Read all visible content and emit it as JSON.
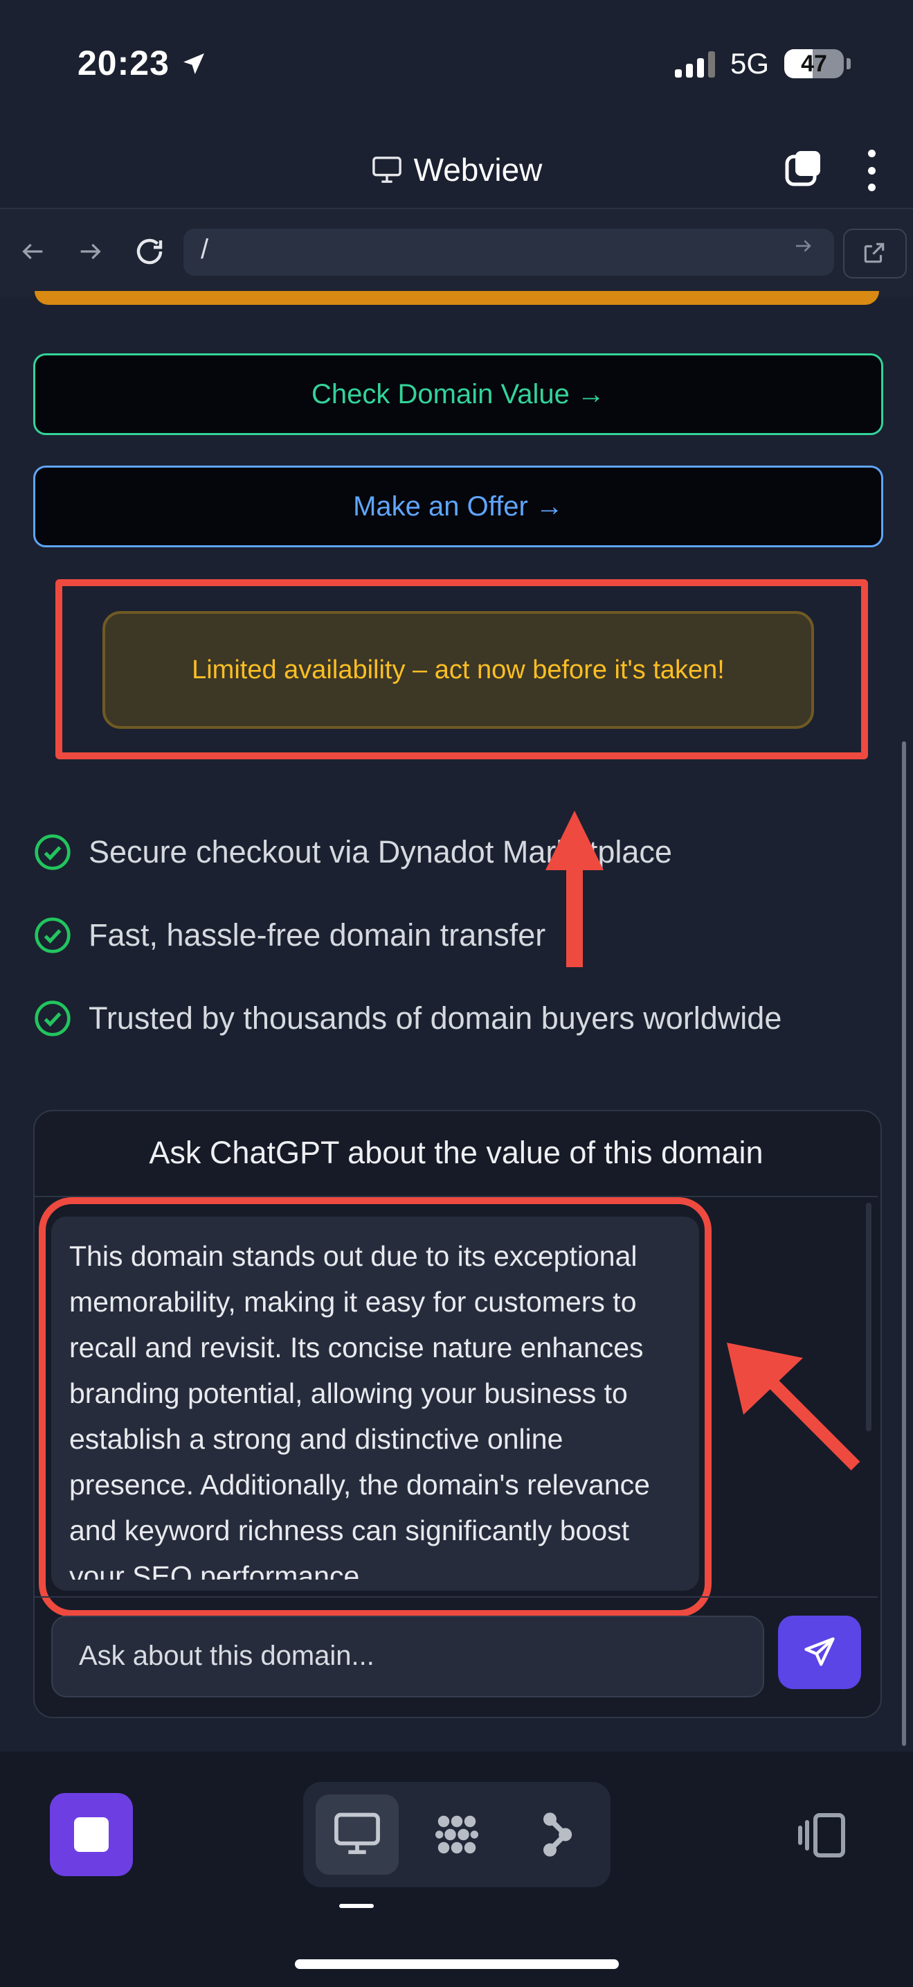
{
  "status_bar": {
    "time": "20:23",
    "network": "5G",
    "battery": "47"
  },
  "header": {
    "title": "Webview"
  },
  "nav": {
    "url": "/"
  },
  "page": {
    "check_value_label": "Check Domain Value →",
    "make_offer_label": "Make an Offer →",
    "notice": "Limited availability – act now before it's taken!",
    "features": [
      "Secure checkout via Dynadot Marketplace",
      "Fast, hassle-free domain transfer",
      "Trusted by thousands of domain buyers worldwide"
    ]
  },
  "chat": {
    "title": "Ask ChatGPT about the value of this domain",
    "response": "This domain stands out due to its exceptional memorability, making it easy for customers to recall and revisit. Its concise nature enhances branding potential, allowing your business to establish a strong and distinctive online presence. Additionally, the domain's relevance and keyword richness can significantly boost your SEO performance,",
    "input_placeholder": "Ask about this domain..."
  },
  "colors": {
    "annotation_red": "#ef4a40",
    "accent_green": "#34d399",
    "accent_blue": "#60a5fa",
    "notice_amber": "#fbbf24",
    "send_purple": "#5b45e6"
  },
  "icons": {
    "header": "monitor-icon",
    "back": "arrow-left-icon",
    "forward": "arrow-right-icon",
    "reload": "reload-icon",
    "external": "external-link-icon",
    "feature": "check-circle-icon",
    "send": "send-icon",
    "tabs": [
      "desktop-icon",
      "grid-dots-icon",
      "branch-icon"
    ]
  }
}
